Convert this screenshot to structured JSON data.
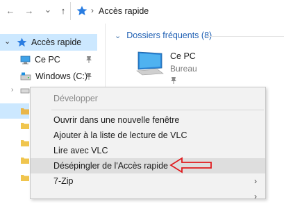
{
  "nav": {
    "back_glyph": "←",
    "forward_glyph": "→",
    "recent_glyph": "⌄",
    "up_glyph": "↑",
    "breadcrumb_chevron": "›",
    "address_text": "Accès rapide"
  },
  "tree": {
    "items": [
      {
        "label": "Accès rapide",
        "icon": "star-icon",
        "selected": true,
        "pinned": false
      },
      {
        "label": "Ce PC",
        "icon": "pc-icon",
        "pinned": true
      },
      {
        "label": "Windows (C:)",
        "icon": "drive-icon",
        "pinned": true
      }
    ],
    "expand_glyph": "›",
    "collapse_glyph": "⌄"
  },
  "content": {
    "section_title": "Dossiers fréquents (8)",
    "tiles": [
      {
        "title": "Ce PC",
        "subtitle": "Bureau",
        "icon": "monitor-icon",
        "pinned": true
      }
    ]
  },
  "context_menu": {
    "items": [
      {
        "label": "Développer",
        "disabled": true
      },
      {
        "label": "Ouvrir dans une nouvelle fenêtre"
      },
      {
        "label": "Ajouter à la liste de lecture de VLC"
      },
      {
        "label": "Lire avec VLC"
      },
      {
        "label": "Désépingler de l'Accès rapide",
        "highlighted": true
      },
      {
        "label": "7-Zip",
        "has_submenu": true
      }
    ],
    "submenu_glyph": "›"
  },
  "colors": {
    "selection": "#cce8ff",
    "accent": "#1e5fb3",
    "annotation_arrow": "#e0191c",
    "menu_background": "#f2f2f2"
  }
}
